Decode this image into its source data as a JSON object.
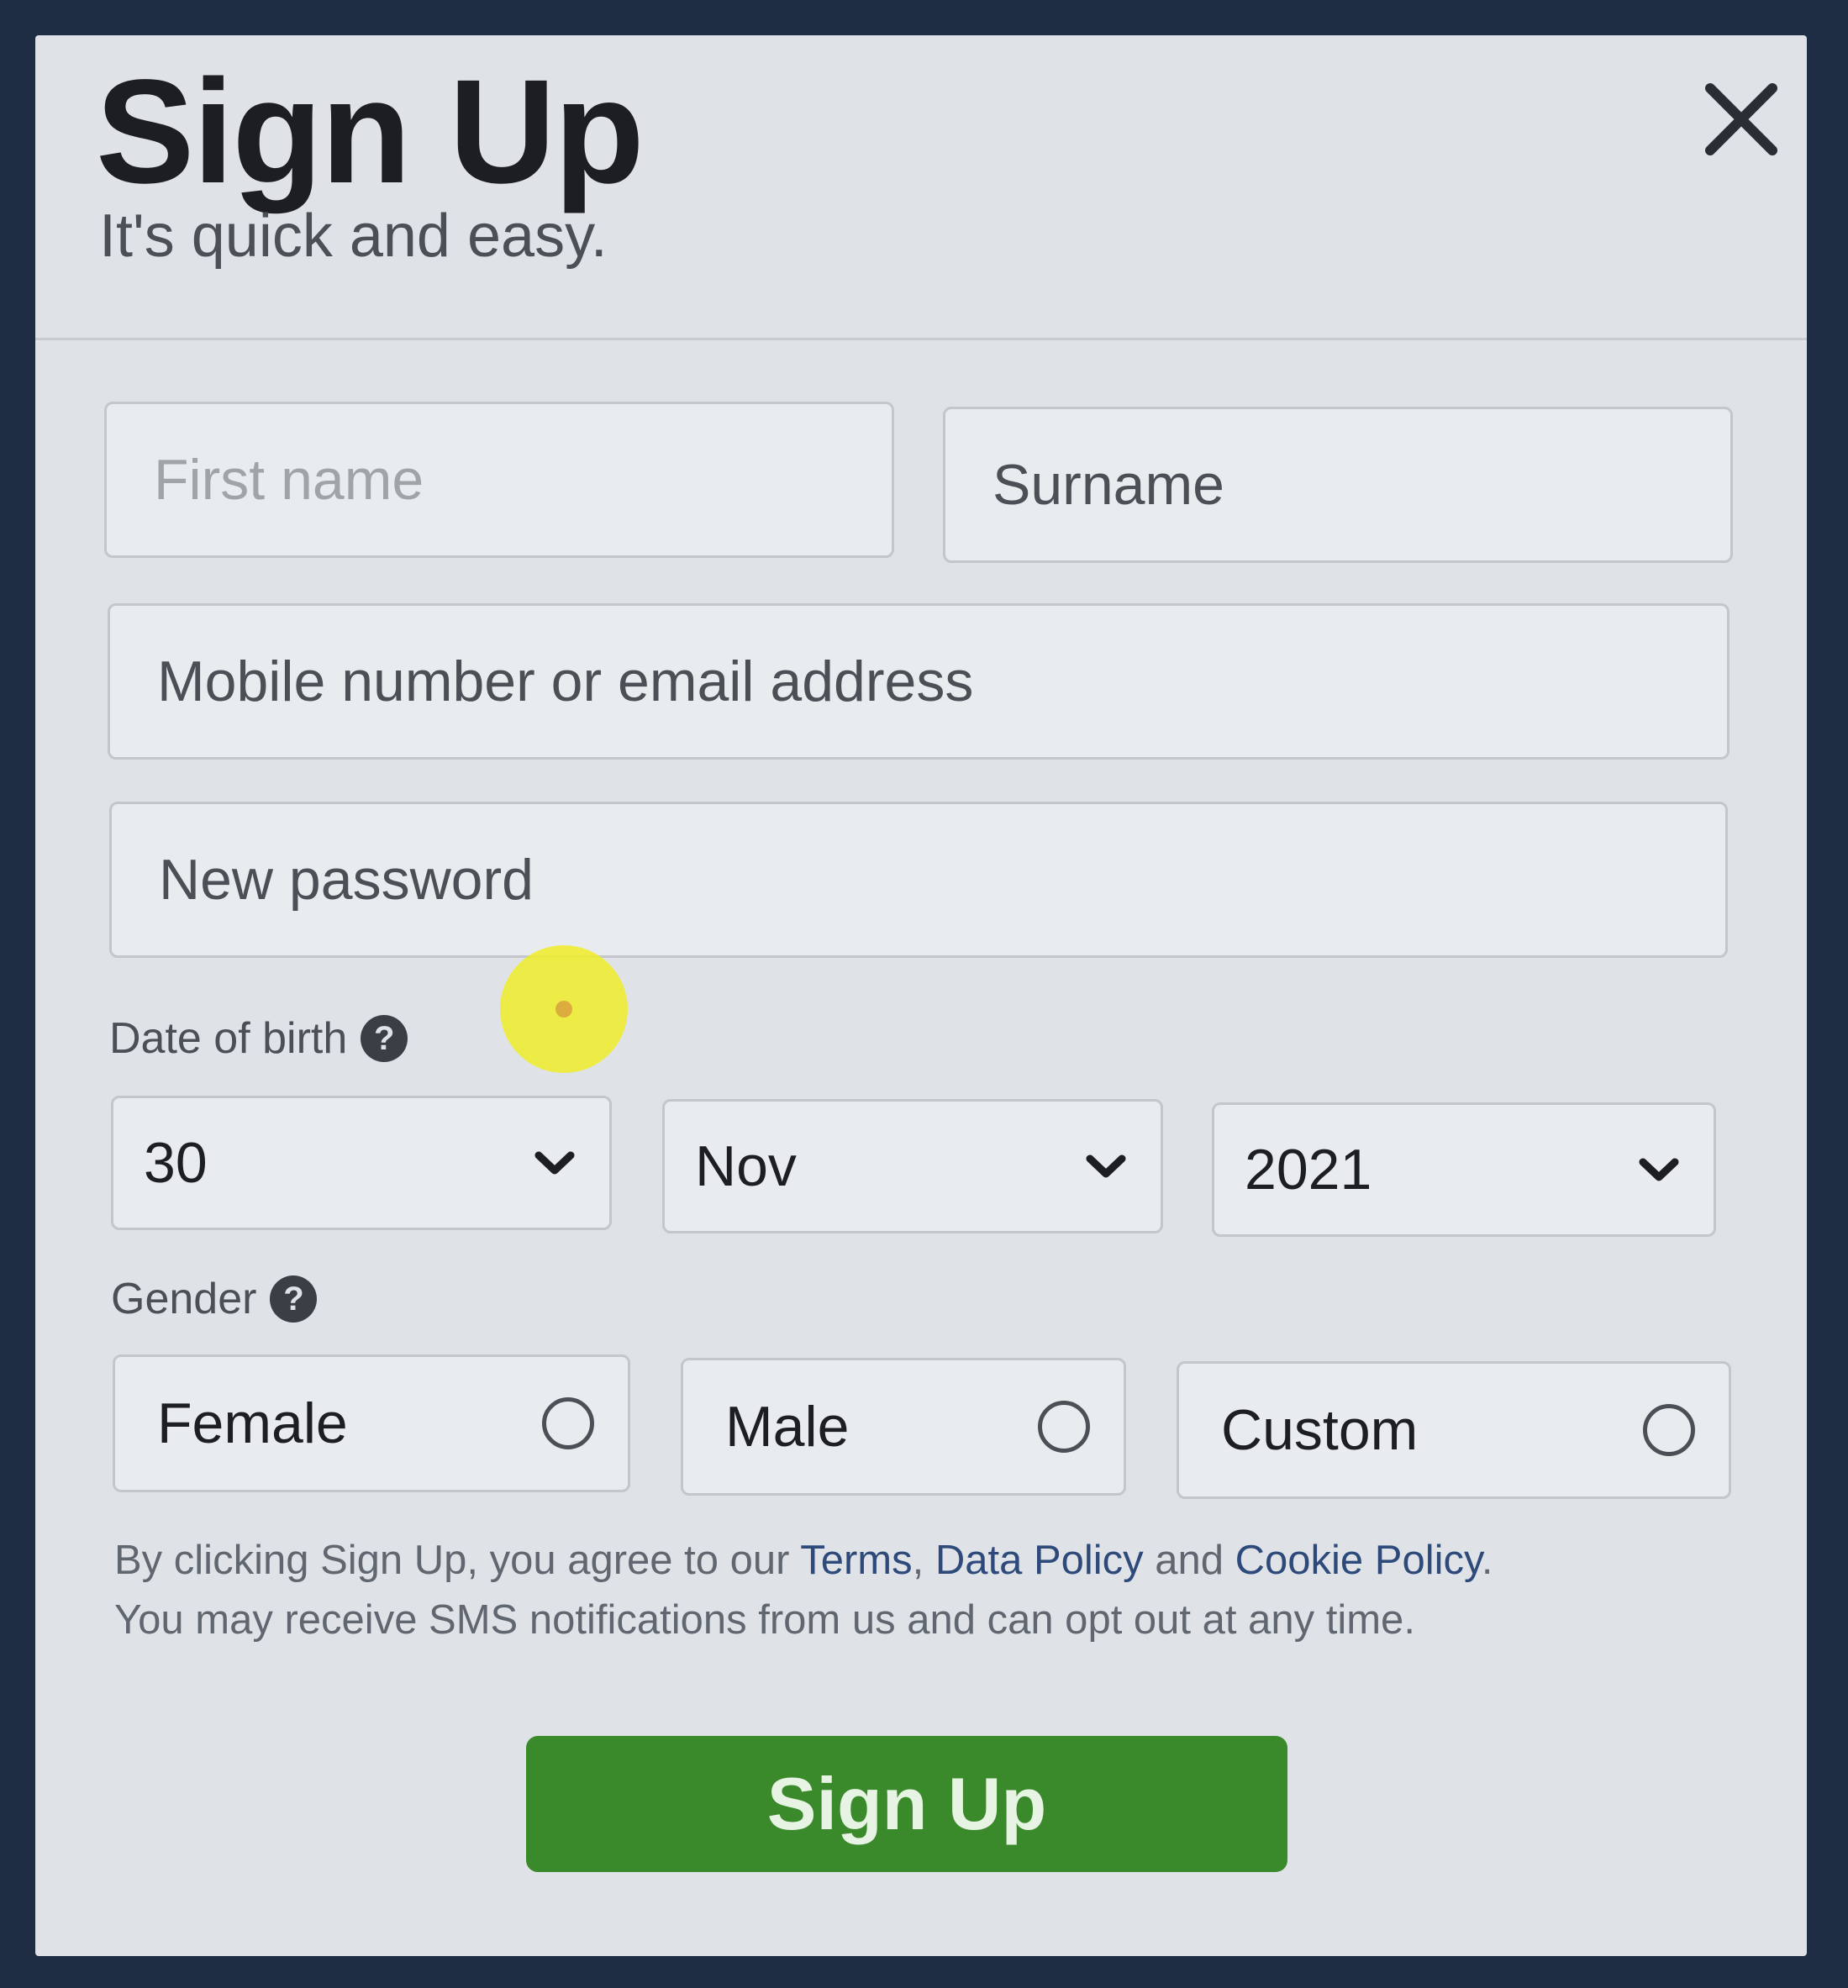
{
  "header": {
    "title": "Sign Up",
    "subtitle": "It's quick and easy.",
    "close_icon": "close-icon"
  },
  "form": {
    "first_name_placeholder": "First name",
    "surname_placeholder": "Surname",
    "contact_placeholder": "Mobile number or email address",
    "password_placeholder": "New password",
    "dob": {
      "label": "Date of birth",
      "help_glyph": "?",
      "day": "30",
      "month": "Nov",
      "year": "2021"
    },
    "gender": {
      "label": "Gender",
      "help_glyph": "?",
      "options": [
        "Female",
        "Male",
        "Custom"
      ]
    }
  },
  "terms": {
    "prefix": "By clicking Sign Up, you agree to our ",
    "terms_link": "Terms",
    "sep1": ", ",
    "data_policy_link": "Data Policy",
    "sep2": " and ",
    "cookie_policy_link": "Cookie Policy",
    "line1_end": ".",
    "line2": "You may receive SMS notifications from us and can opt out at any time."
  },
  "submit": {
    "label": "Sign Up",
    "color": "#3a8a2c"
  },
  "colors": {
    "backdrop": "#1e2c44",
    "dialog_bg": "#dfe3e7",
    "link": "#2d4a7a"
  }
}
